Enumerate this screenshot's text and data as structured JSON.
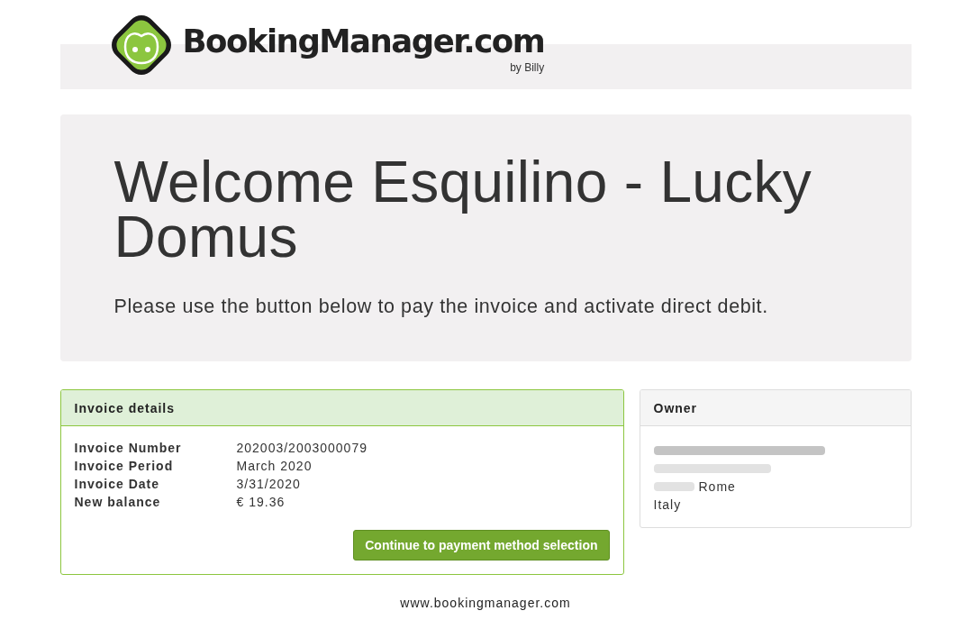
{
  "header": {
    "logo_text": "BookingManager.com",
    "logo_subtext": "by Billy"
  },
  "hero": {
    "title": "Welcome Esquilino - Lucky Domus",
    "message": "Please use the button below to pay the invoice and activate direct debit."
  },
  "invoice": {
    "title": "Invoice details",
    "rows": [
      {
        "label": "Invoice Number",
        "value": "202003/2003000079"
      },
      {
        "label": "Invoice Period",
        "value": "March 2020"
      },
      {
        "label": "Invoice Date",
        "value": "3/31/2020"
      },
      {
        "label": "New balance",
        "value": "€ 19.36"
      }
    ],
    "button": "Continue to payment method selection"
  },
  "owner": {
    "title": "Owner",
    "lines": [
      {
        "parts": [
          {
            "kind": "redacted"
          }
        ]
      },
      {
        "parts": [
          {
            "kind": "redacted"
          }
        ]
      },
      {
        "parts": [
          {
            "kind": "redacted"
          },
          {
            "kind": "text",
            "text": "Rome"
          }
        ]
      },
      {
        "parts": [
          {
            "kind": "text",
            "text": "Italy"
          }
        ]
      }
    ]
  },
  "footer": "www.bookingmanager.com"
}
